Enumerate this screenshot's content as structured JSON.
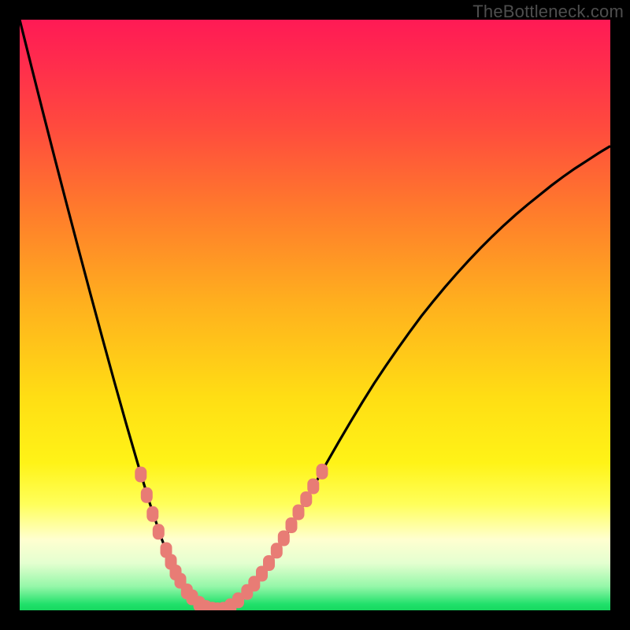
{
  "watermark": "TheBottleneck.com",
  "colors": {
    "frame": "#000000",
    "curve": "#000000",
    "marker": "#e87c75",
    "gradient_top": "#ff1a55",
    "gradient_bottom": "#18d860"
  },
  "chart_data": {
    "type": "line",
    "title": "",
    "xlabel": "",
    "ylabel": "",
    "xlim": [
      0,
      100
    ],
    "ylim": [
      0,
      100
    ],
    "x": [
      0,
      2,
      4,
      6,
      8,
      10,
      12,
      14,
      16,
      18,
      20,
      22,
      24,
      26,
      28,
      30,
      32,
      34,
      36,
      38,
      40,
      42,
      44,
      46,
      48,
      50,
      52,
      54,
      56,
      58,
      60,
      62,
      64,
      66,
      68,
      70,
      72,
      74,
      76,
      78,
      80,
      82,
      84,
      86,
      88,
      90,
      92,
      94,
      96,
      98,
      100
    ],
    "series": [
      {
        "name": "bottleneck-curve",
        "values": [
          100,
          92.0,
          84.1,
          76.3,
          68.6,
          61.0,
          53.5,
          46.1,
          38.8,
          31.7,
          24.8,
          18.2,
          12.2,
          7.0,
          3.1,
          0.9,
          0.0,
          0.1,
          0.7,
          2.2,
          4.5,
          7.4,
          10.7,
          14.2,
          17.8,
          21.4,
          25.0,
          28.5,
          31.9,
          35.2,
          38.4,
          41.4,
          44.3,
          47.1,
          49.8,
          52.3,
          54.7,
          57.0,
          59.2,
          61.3,
          63.3,
          65.2,
          67.0,
          68.7,
          70.3,
          71.9,
          73.4,
          74.8,
          76.1,
          77.4,
          78.6
        ]
      }
    ],
    "markers": {
      "name": "highlighted-points",
      "points": [
        {
          "x": 20.5,
          "y": 23.0
        },
        {
          "x": 21.5,
          "y": 19.5
        },
        {
          "x": 22.5,
          "y": 16.3
        },
        {
          "x": 23.5,
          "y": 13.3
        },
        {
          "x": 24.8,
          "y": 10.2
        },
        {
          "x": 25.6,
          "y": 8.2
        },
        {
          "x": 26.4,
          "y": 6.4
        },
        {
          "x": 27.2,
          "y": 5.0
        },
        {
          "x": 28.3,
          "y": 3.2
        },
        {
          "x": 29.2,
          "y": 2.2
        },
        {
          "x": 30.4,
          "y": 1.1
        },
        {
          "x": 31.5,
          "y": 0.4
        },
        {
          "x": 32.6,
          "y": 0.1
        },
        {
          "x": 33.5,
          "y": 0.0
        },
        {
          "x": 34.5,
          "y": 0.1
        },
        {
          "x": 35.7,
          "y": 0.7
        },
        {
          "x": 37.0,
          "y": 1.7
        },
        {
          "x": 38.5,
          "y": 3.1
        },
        {
          "x": 39.7,
          "y": 4.5
        },
        {
          "x": 41.0,
          "y": 6.2
        },
        {
          "x": 42.2,
          "y": 8.0
        },
        {
          "x": 43.5,
          "y": 10.1
        },
        {
          "x": 44.7,
          "y": 12.2
        },
        {
          "x": 46.0,
          "y": 14.4
        },
        {
          "x": 47.2,
          "y": 16.6
        },
        {
          "x": 48.5,
          "y": 18.8
        },
        {
          "x": 49.7,
          "y": 21.0
        },
        {
          "x": 51.2,
          "y": 23.5
        }
      ]
    }
  }
}
